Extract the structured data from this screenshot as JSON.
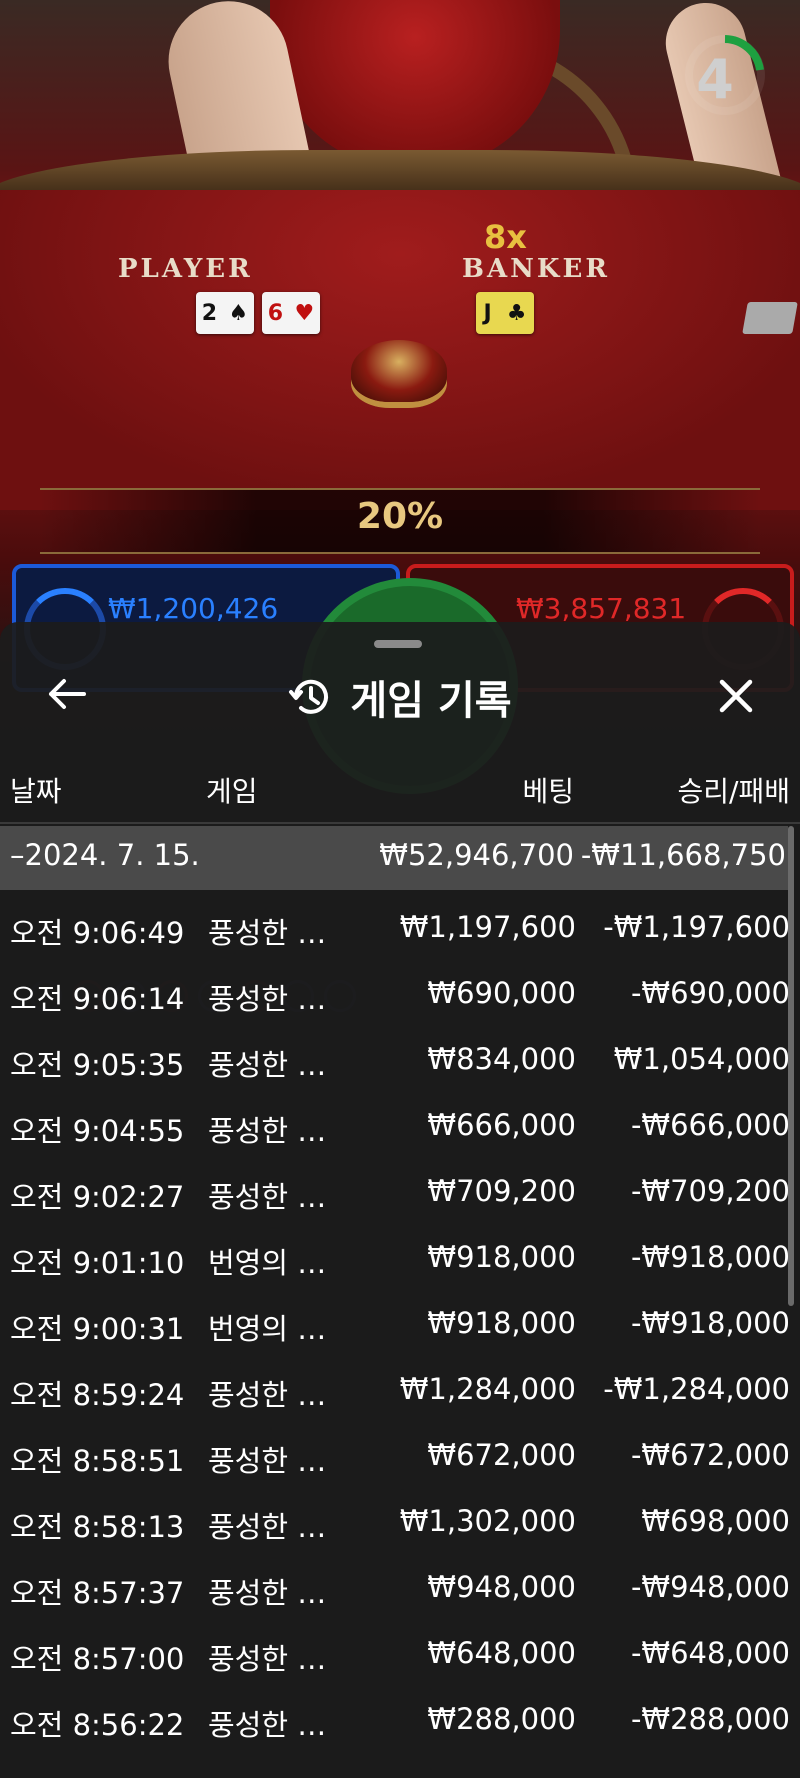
{
  "game_scene": {
    "timer_value": "4",
    "player_label": "PLAYER",
    "banker_label": "BANKER",
    "banker_multiplier": "8x",
    "player_cards": [
      {
        "rank": "2",
        "suit": "♠",
        "color": "black"
      },
      {
        "rank": "6",
        "suit": "♥",
        "color": "red"
      }
    ],
    "banker_cards": [
      {
        "rank": "J",
        "suit": "♣",
        "color": "gold"
      }
    ],
    "percentage": "20%",
    "player_bet_total": "₩1,200,426",
    "banker_bet_total": "₩3,857,831"
  },
  "history": {
    "title": "게임 기록",
    "columns": {
      "date": "날짜",
      "game": "게임",
      "bet": "베팅",
      "win_loss": "승리/패배"
    },
    "summary": {
      "date": "–2024. 7. 15.",
      "bet": "₩52,946,700",
      "win_loss": "-₩11,668,750"
    },
    "rows": [
      {
        "time": "오전 9:06:49",
        "game": "풍성한 골...",
        "bet": "₩1,197,600",
        "win_loss": "-₩1,197,600"
      },
      {
        "time": "오전 9:06:14",
        "game": "풍성한 골...",
        "bet": "₩690,000",
        "win_loss": "-₩690,000"
      },
      {
        "time": "오전 9:05:35",
        "game": "풍성한 골...",
        "bet": "₩834,000",
        "win_loss": "₩1,054,000"
      },
      {
        "time": "오전 9:04:55",
        "game": "풍성한 골...",
        "bet": "₩666,000",
        "win_loss": "-₩666,000"
      },
      {
        "time": "오전 9:02:27",
        "game": "풍성한 골...",
        "bet": "₩709,200",
        "win_loss": "-₩709,200"
      },
      {
        "time": "오전 9:01:10",
        "game": "번영의 나...",
        "bet": "₩918,000",
        "win_loss": "-₩918,000"
      },
      {
        "time": "오전 9:00:31",
        "game": "번영의 나...",
        "bet": "₩918,000",
        "win_loss": "-₩918,000"
      },
      {
        "time": "오전 8:59:24",
        "game": "풍성한 골...",
        "bet": "₩1,284,000",
        "win_loss": "-₩1,284,000"
      },
      {
        "time": "오전 8:58:51",
        "game": "풍성한 골...",
        "bet": "₩672,000",
        "win_loss": "-₩672,000"
      },
      {
        "time": "오전 8:58:13",
        "game": "풍성한 골...",
        "bet": "₩1,302,000",
        "win_loss": "₩698,000"
      },
      {
        "time": "오전 8:57:37",
        "game": "풍성한 골...",
        "bet": "₩948,000",
        "win_loss": "-₩948,000"
      },
      {
        "time": "오전 8:57:00",
        "game": "풍성한 골...",
        "bet": "₩648,000",
        "win_loss": "-₩648,000"
      },
      {
        "time": "오전 8:56:22",
        "game": "풍성한 골...",
        "bet": "₩288,000",
        "win_loss": "-₩288,000"
      }
    ]
  },
  "icons": {
    "back": "arrow-left-icon",
    "history": "history-clock-icon",
    "close": "close-icon"
  }
}
